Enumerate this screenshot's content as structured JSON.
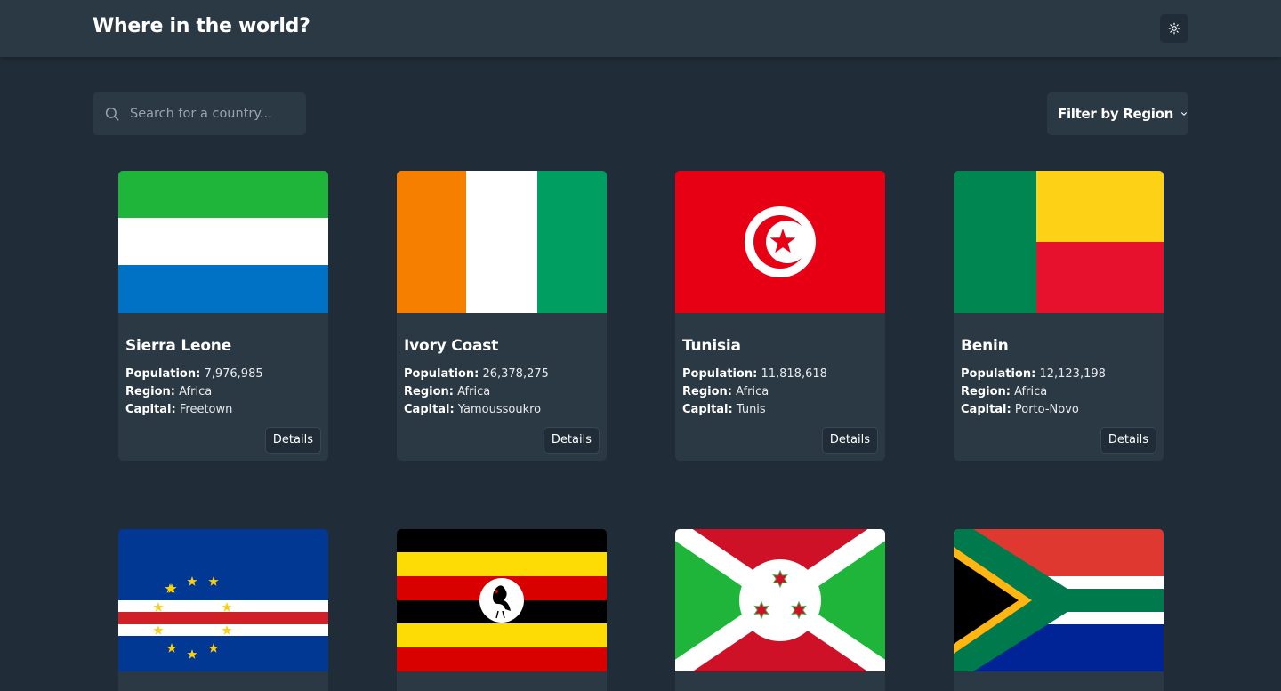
{
  "header": {
    "title": "Where in the world?",
    "theme_toggle_icon": "sun-icon"
  },
  "search": {
    "placeholder": "Search for a country...",
    "value": "",
    "icon": "search-icon"
  },
  "filter": {
    "label": "Filter by Region",
    "icon": "chevron-down-icon"
  },
  "labels": {
    "population": "Population:",
    "region": "Region:",
    "capital": "Capital:",
    "details": "Details"
  },
  "countries": [
    {
      "name": "Sierra Leone",
      "population": "7,976,985",
      "region": "Africa",
      "capital": "Freetown",
      "flag": "sierra-leone-flag"
    },
    {
      "name": "Ivory Coast",
      "population": "26,378,275",
      "region": "Africa",
      "capital": "Yamoussoukro",
      "flag": "ivory-coast-flag"
    },
    {
      "name": "Tunisia",
      "population": "11,818,618",
      "region": "Africa",
      "capital": "Tunis",
      "flag": "tunisia-flag"
    },
    {
      "name": "Benin",
      "population": "12,123,198",
      "region": "Africa",
      "capital": "Porto-Novo",
      "flag": "benin-flag"
    },
    {
      "flag": "cape-verde-flag"
    },
    {
      "flag": "uganda-flag"
    },
    {
      "flag": "burundi-flag"
    },
    {
      "flag": "south-africa-flag"
    }
  ],
  "colors": {
    "background": "#202c37",
    "surface": "#2b3945",
    "text": "#ffffff"
  }
}
